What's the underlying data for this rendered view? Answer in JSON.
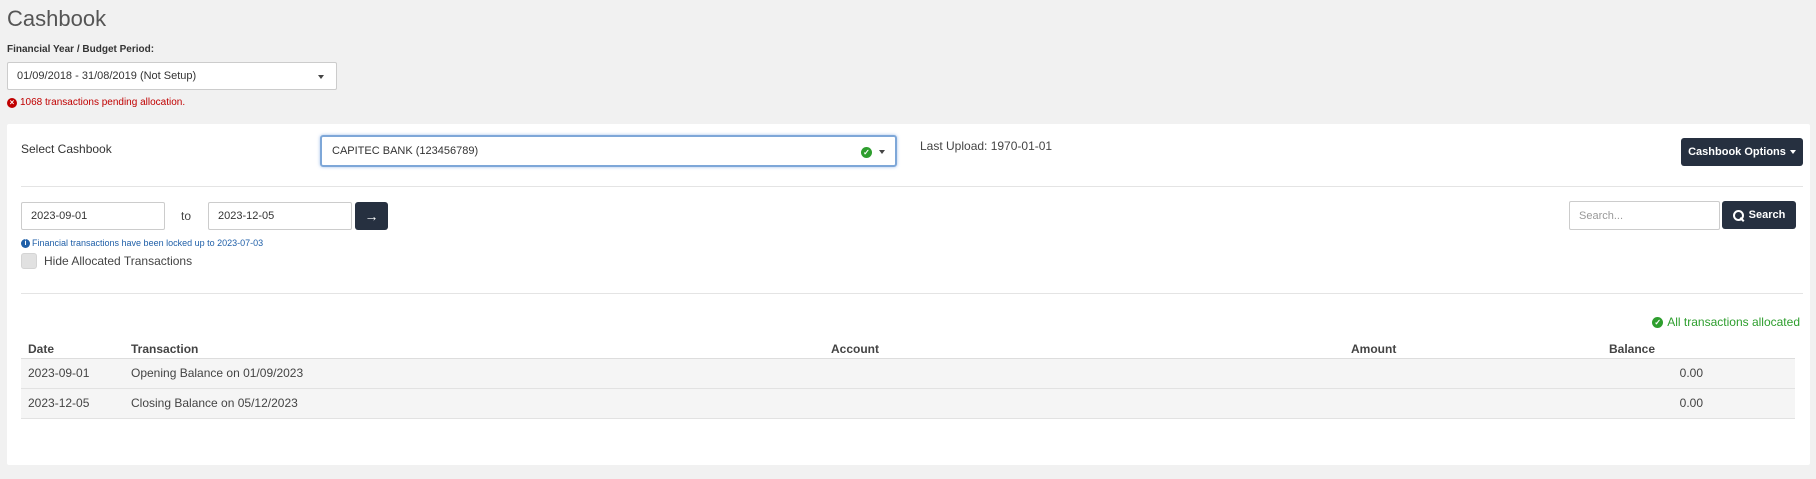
{
  "page": {
    "title": "Cashbook",
    "fy_label": "Financial Year / Budget Period:",
    "fy_value": "01/09/2018 - 31/08/2019 (Not Setup)",
    "pending_message": "1068 transactions pending allocation."
  },
  "cashbook": {
    "select_label": "Select Cashbook",
    "selected": "CAPITEC BANK (123456789)",
    "last_upload": "Last Upload: 1970-01-01",
    "options_label": "Cashbook Options"
  },
  "filters": {
    "from_date": "2023-09-01",
    "to_label": "to",
    "to_date": "2023-12-05",
    "lock_note": "Financial transactions have been locked up to 2023-07-03",
    "hide_allocated_label": "Hide Allocated Transactions",
    "search_placeholder": "Search...",
    "search_label": "Search"
  },
  "status": {
    "all_allocated": "All transactions allocated"
  },
  "table": {
    "headers": {
      "date": "Date",
      "transaction": "Transaction",
      "account": "Account",
      "amount": "Amount",
      "balance": "Balance"
    },
    "rows": [
      {
        "date": "2023-09-01",
        "transaction": "Opening Balance on 01/09/2023",
        "account": "",
        "amount": "",
        "balance": "0.00"
      },
      {
        "date": "2023-12-05",
        "transaction": "Closing Balance on 05/12/2023",
        "account": "",
        "amount": "",
        "balance": "0.00"
      }
    ]
  },
  "icons": {
    "error": "error-circle-icon",
    "success": "check-circle-icon",
    "info": "info-circle-icon",
    "arrow": "arrow-right-icon",
    "search": "search-icon"
  },
  "colors": {
    "accent_dark": "#263040",
    "error": "#c00000",
    "success": "#2e9e2e",
    "info": "#1f5fa8"
  }
}
